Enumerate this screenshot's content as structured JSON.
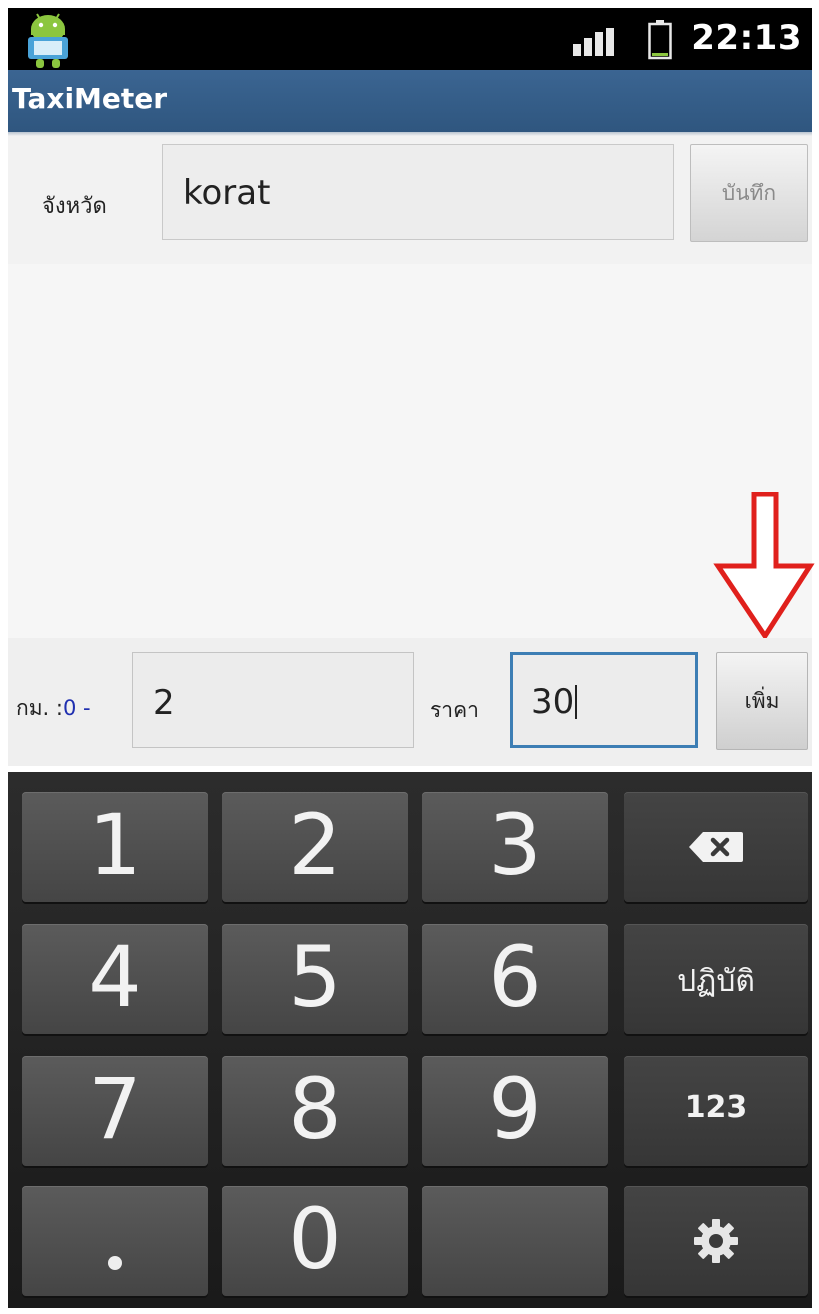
{
  "status_bar": {
    "time": "22:13",
    "icons": [
      "android-notification-icon",
      "signal-icon",
      "battery-icon"
    ]
  },
  "app": {
    "title": "TaxiMeter"
  },
  "province": {
    "label": "จังหวัด",
    "value": "korat",
    "save_label": "บันทึก"
  },
  "add_row": {
    "km_label": "กม. :",
    "km_range": "0 -",
    "km_value": "2",
    "price_label": "ราคา",
    "price_value": "30",
    "add_label": "เพิ่ม"
  },
  "annotation": {
    "arrow_color": "#e0201c",
    "points_to": "add-button"
  },
  "keyboard": {
    "keys": [
      "1",
      "2",
      "3",
      "backspace-icon",
      "4",
      "5",
      "6",
      "ปฏิบัติ",
      "7",
      "8",
      "9",
      "123",
      ".",
      "0",
      "",
      "gear-icon"
    ],
    "labels": {
      "k1": "1",
      "k2": "2",
      "k3": "3",
      "k4": "4",
      "k5": "5",
      "k6": "6",
      "k7": "7",
      "k8": "8",
      "k9": "9",
      "k0": "0",
      "action": "ปฏิบัติ",
      "mode": "123"
    }
  },
  "colors": {
    "title_bar": "#2f567f",
    "focus_border": "#3d7eb4",
    "range_text": "#1f2fb0"
  }
}
